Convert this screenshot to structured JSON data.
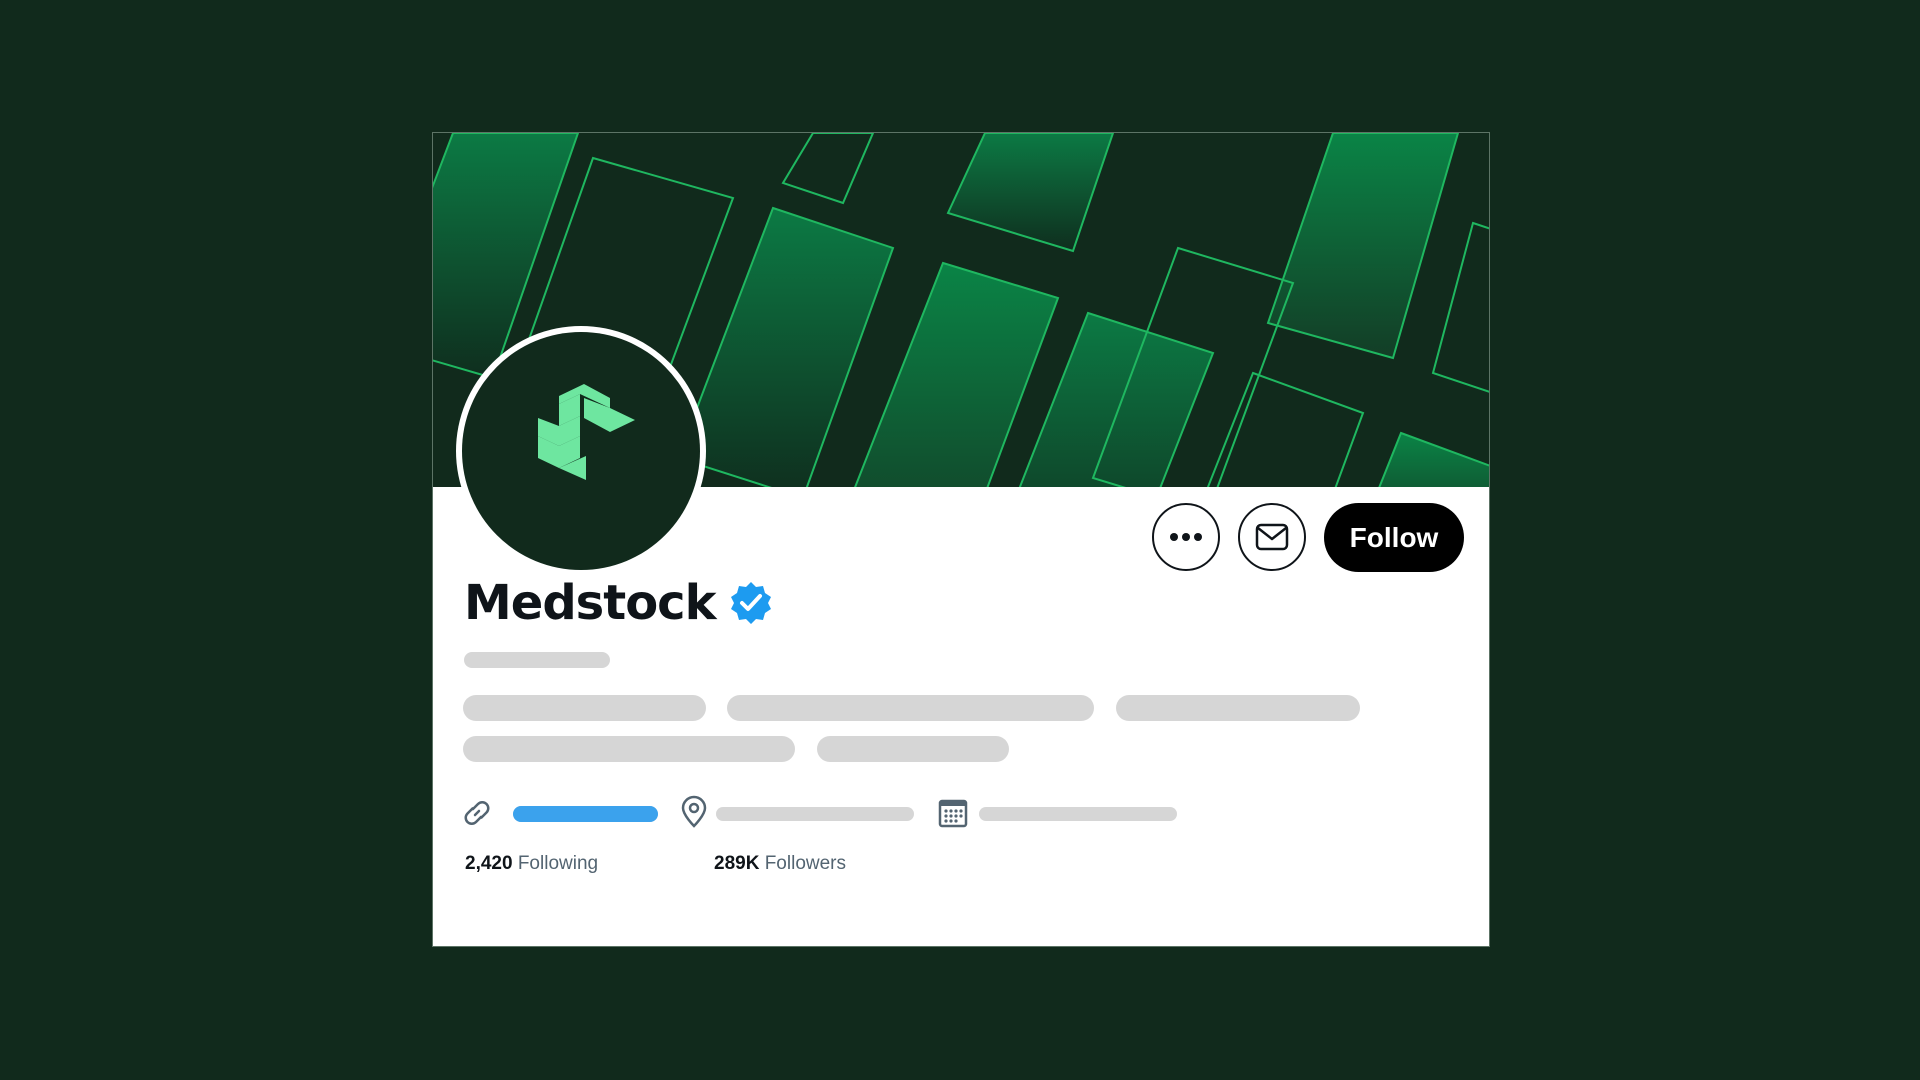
{
  "profile": {
    "name": "Medstock",
    "verified": true,
    "avatar_icon": "medstock-logo-icon",
    "banner": "green-isometric-grid-banner"
  },
  "actions": {
    "more_icon": "more-horizontal-icon",
    "message_icon": "mail-icon",
    "follow_label": "Follow"
  },
  "meta": {
    "link_icon": "link-icon",
    "location_icon": "location-pin-icon",
    "calendar_icon": "calendar-icon"
  },
  "stats": {
    "following_count": "2,420",
    "following_label": "Following",
    "followers_count": "289K",
    "followers_label": "Followers"
  },
  "colors": {
    "background": "#112a1c",
    "accent_green": "#6ee6a0",
    "verified_blue": "#1d9bf0",
    "link_blue": "#3ba2ed",
    "skeleton_gray": "#d6d6d6"
  }
}
